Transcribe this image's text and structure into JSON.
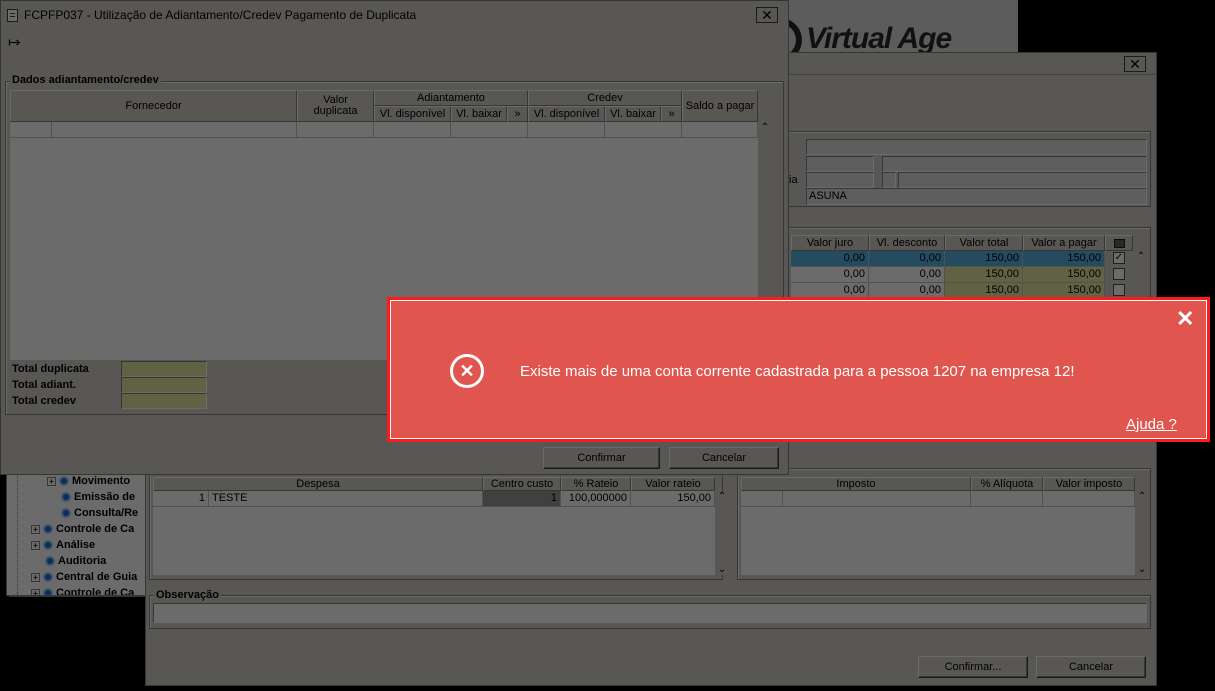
{
  "background_window": {
    "logo_text": "Virtual Age",
    "partial_label": "ia",
    "name_field_value": "ASUNA",
    "duplicates_table": {
      "headers": [
        "Valor juro",
        "Vl. desconto",
        "Valor total",
        "Valor a pagar"
      ],
      "rows": [
        [
          "0,00",
          "0,00",
          "150,00",
          "150,00"
        ],
        [
          "0,00",
          "0,00",
          "150,00",
          "150,00"
        ],
        [
          "0,00",
          "0,00",
          "150,00",
          "150,00"
        ]
      ],
      "row_checked": [
        true,
        false,
        false
      ]
    },
    "tree": {
      "items": [
        {
          "label": "Movimento",
          "expander": "+"
        },
        {
          "label": "Emissão de",
          "expander": ""
        },
        {
          "label": "Consulta/Re",
          "expander": ""
        },
        {
          "label": "Controle de Ca",
          "expander": "+"
        },
        {
          "label": "Análise",
          "expander": "+"
        },
        {
          "label": "Auditoria",
          "expander": ""
        },
        {
          "label": "Central de Guia",
          "expander": "+"
        },
        {
          "label": "Controle de Ca",
          "expander": "+"
        }
      ]
    },
    "expense_table": {
      "headers": [
        "Despesa",
        "Centro custo",
        "% Rateio",
        "Valor rateio"
      ],
      "rows": [
        {
          "num": "1",
          "desc": "TESTE",
          "centro": "1",
          "rateio": "100,000000",
          "valor": "150,00"
        }
      ]
    },
    "tax_table": {
      "headers": [
        "Imposto",
        "% Alíquota",
        "Valor imposto"
      ]
    },
    "observacao_label": "Observação",
    "confirm_label": "Confirmar...",
    "cancel_label": "Cancelar"
  },
  "front_window": {
    "title": "FCPFP037 - Utilização de Adiantamento/Credev Pagamento de Duplicata",
    "group_title": "Dados adiantamento/credev",
    "headers": {
      "fornecedor": "Fornecedor",
      "valor_duplicata": "Valor duplicata",
      "adiantamento": "Adiantamento",
      "credev": "Credev",
      "saldo": "Saldo a pagar",
      "vl_disponivel": "Vl. disponível",
      "vl_baixar": "Vl. baixar",
      "more": "»"
    },
    "totals": {
      "duplicata": "Total duplicata",
      "adiant": "Total adiant.",
      "credev": "Total credev"
    },
    "confirm_label": "Confirmar",
    "cancel_label": "Cancelar"
  },
  "alert": {
    "message": "Existe mais de uma conta corrente cadastrada para a pessoa 1207 na empresa 12!",
    "help_link": "Ajuda ?",
    "bg_color": "#e0554d",
    "border_color": "#ff1a1a"
  }
}
